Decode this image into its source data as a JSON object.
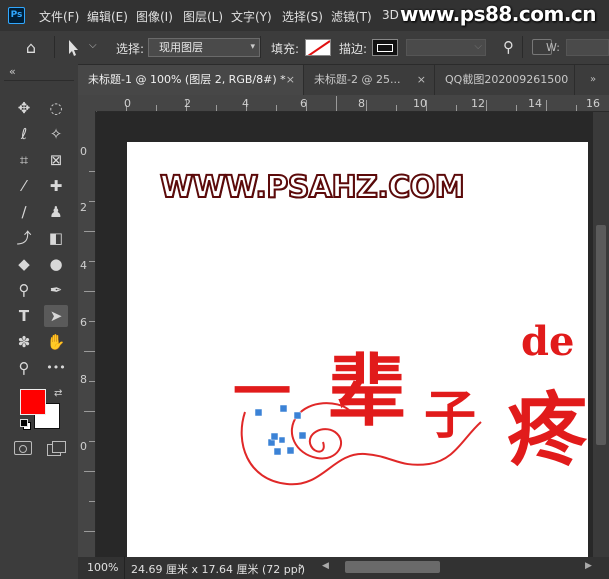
{
  "app": {
    "logo_text": "Ps"
  },
  "menubar": {
    "items": [
      "文件(F)",
      "编辑(E)",
      "图像(I)",
      "图层(L)",
      "文字(Y)",
      "选择(S)",
      "滤镜(T)",
      "3D"
    ],
    "watermark": "www.ps88.com.cn"
  },
  "options": {
    "select_label": "选择:",
    "select_value": "现用图层",
    "fill_label": "填充:",
    "stroke_label": "描边:",
    "w_label": "W:"
  },
  "tabs": [
    {
      "label": "未标题-1 @ 100% (图层 2, RGB/8#) *",
      "close": "×",
      "active": true
    },
    {
      "label": "未标题-2 @ 25...",
      "close": "×",
      "active": false
    },
    {
      "label": "QQ截图202009261500",
      "close": "",
      "active": false
    }
  ],
  "panel_collapse_glyph": "«",
  "ruler_top": [
    "0",
    "2",
    "4",
    "6",
    "8",
    "10",
    "12",
    "14",
    "16"
  ],
  "ruler_left": [
    "0",
    "2",
    "4",
    "6",
    "8",
    "0"
  ],
  "tools": [
    {
      "name": "move-tool",
      "glyph": "✥"
    },
    {
      "name": "marquee-tool",
      "glyph": "◌"
    },
    {
      "name": "lasso-tool",
      "glyph": "ℓ"
    },
    {
      "name": "magic-wand-tool",
      "glyph": "✧"
    },
    {
      "name": "crop-tool",
      "glyph": "⌗"
    },
    {
      "name": "frame-tool",
      "glyph": "⊠"
    },
    {
      "name": "eyedropper-tool",
      "glyph": "⁄"
    },
    {
      "name": "healing-brush-tool",
      "glyph": "✚"
    },
    {
      "name": "brush-tool",
      "glyph": "∕"
    },
    {
      "name": "clone-stamp-tool",
      "glyph": "♟"
    },
    {
      "name": "history-brush-tool",
      "glyph": "⤴"
    },
    {
      "name": "eraser-tool",
      "glyph": "◧"
    },
    {
      "name": "paint-bucket-tool",
      "glyph": "◆"
    },
    {
      "name": "blur-tool",
      "glyph": "●"
    },
    {
      "name": "dodge-tool",
      "glyph": "⚲"
    },
    {
      "name": "pen-tool",
      "glyph": "✒"
    },
    {
      "name": "type-tool",
      "glyph": "T"
    },
    {
      "name": "path-selection-tool",
      "glyph": "➤"
    },
    {
      "name": "custom-shape-tool",
      "glyph": "✽"
    },
    {
      "name": "hand-tool",
      "glyph": "✋"
    },
    {
      "name": "zoom-tool",
      "glyph": "⚲"
    },
    {
      "name": "more-tools",
      "glyph": "•••"
    }
  ],
  "colors": {
    "foreground": "#ff0000",
    "background": "#ffffff",
    "accent": "#d71920",
    "path_anchor": "#3b82d6"
  },
  "canvas": {
    "url_text": "WWW.PSAHZ.COM",
    "char_1": "一",
    "char_2": "辈",
    "char_3": "子",
    "char_4": "疼",
    "en_text": "de"
  },
  "status": {
    "zoom": "100%",
    "doc_size": "24.69 厘米 x 17.64 厘米 (72 ppi)",
    "arrow": "›"
  }
}
